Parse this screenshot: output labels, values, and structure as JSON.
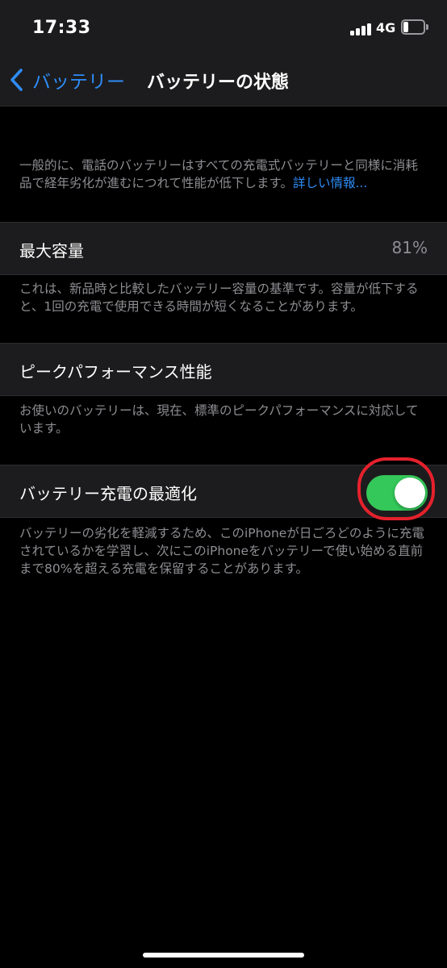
{
  "status_bar": {
    "time": "17:33",
    "network": "4G",
    "battery_level": 0.25,
    "signal_bars": 4
  },
  "nav": {
    "back_label": "バッテリー",
    "title": "バッテリーの状態",
    "back_icon": "chevron-left-icon"
  },
  "intro": {
    "text": "一般的に、電話のバッテリーはすべての充電式バッテリーと同様に消耗品で経年劣化が進むにつれて性能が低下します。",
    "link": "詳しい情報..."
  },
  "max_capacity": {
    "label": "最大容量",
    "value": "81%",
    "footer": "これは、新品時と比較したバッテリー容量の基準です。容量が低下すると、1回の充電で使用できる時間が短くなることがあります。"
  },
  "peak_performance": {
    "label": "ピークパフォーマンス性能",
    "footer": "お使いのバッテリーは、現在、標準のピークパフォーマンスに対応しています。"
  },
  "optimized_charging": {
    "label": "バッテリー充電の最適化",
    "enabled": true,
    "footer": "バッテリーの劣化を軽減するため、このiPhoneが日ごろどのように充電されているかを学習し、次にこのiPhoneをバッテリーで使い始める直前まで80%を超える充電を保留することがあります。"
  },
  "colors": {
    "background": "#000000",
    "cell": "#1c1c1e",
    "accent": "#2e8cf6",
    "toggle_on": "#34c759",
    "secondary_text": "#8e8e93",
    "annotation": "#e5212c"
  }
}
